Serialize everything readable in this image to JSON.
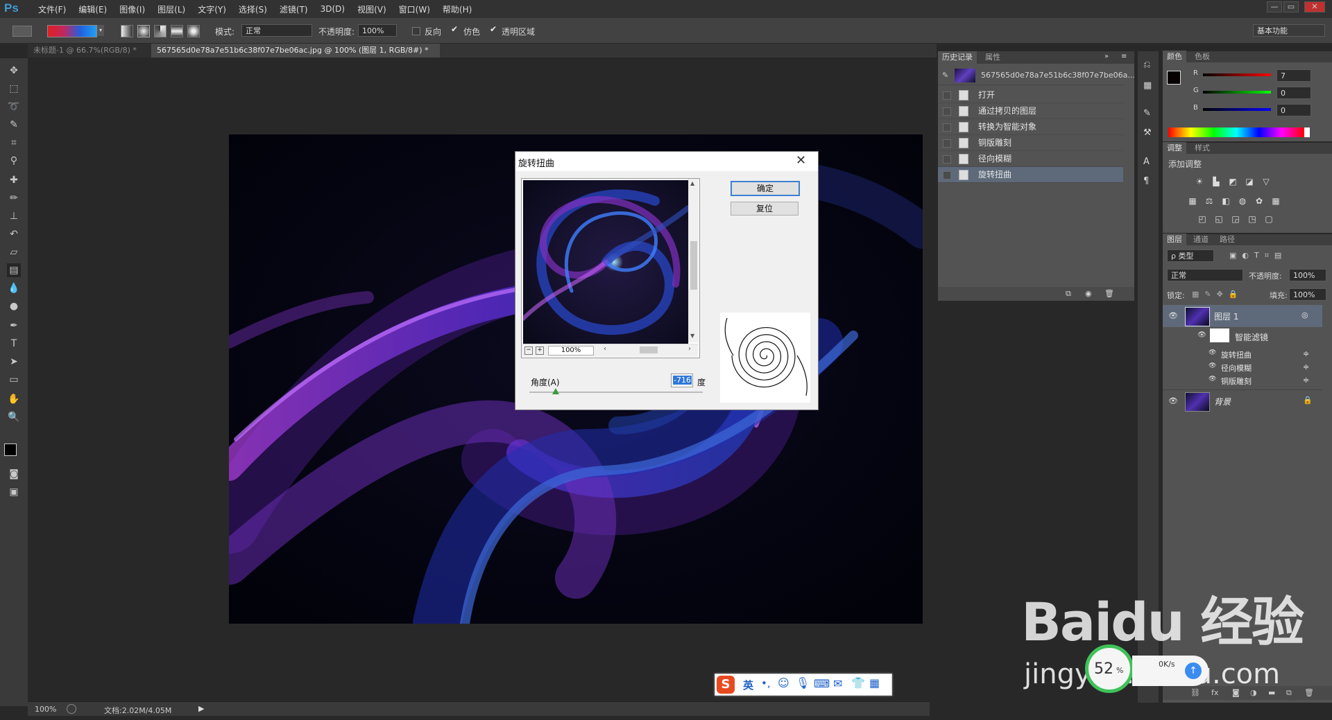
{
  "app": {
    "logo": "Ps"
  },
  "menu": [
    "文件(F)",
    "编辑(E)",
    "图像(I)",
    "图层(L)",
    "文字(Y)",
    "选择(S)",
    "滤镜(T)",
    "3D(D)",
    "视图(V)",
    "窗口(W)",
    "帮助(H)"
  ],
  "window_controls": [
    "—",
    "▭",
    "✕"
  ],
  "options": {
    "mode_label": "模式:",
    "mode_value": "正常",
    "opacity_label": "不透明度:",
    "opacity_value": "100%",
    "reverse_label": "反向",
    "dither_label": "仿色",
    "transparency_label": "透明区域",
    "workspace": "基本功能"
  },
  "tabs": [
    {
      "label": "未标题-1 @ 66.7%(RGB/8) *"
    },
    {
      "label": "567565d0e78a7e51b6c38f07e7be06ac.jpg @ 100% (图层 1, RGB/8#) *"
    }
  ],
  "status": {
    "zoom": "100%",
    "doc": "文档:2.02M/4.05M"
  },
  "history_panel": {
    "tabs": [
      "历史记录",
      "属性"
    ],
    "snapshot": "567565d0e78a7e51b6c38f07e7be06a...",
    "items": [
      "打开",
      "通过拷贝的图层",
      "转换为智能对象",
      "铜版雕刻",
      "径向模糊",
      "旋转扭曲"
    ]
  },
  "color_panel": {
    "tabs": [
      "颜色",
      "色板"
    ],
    "channels": [
      {
        "label": "R",
        "value": "7",
        "color": "#e02020"
      },
      {
        "label": "G",
        "value": "0",
        "color": "#20c020"
      },
      {
        "label": "B",
        "value": "0",
        "color": "#2030e0"
      }
    ]
  },
  "adjust_panel": {
    "tabs": [
      "调整",
      "样式"
    ],
    "title": "添加调整"
  },
  "layers_panel": {
    "tabs": [
      "图层",
      "通道",
      "路径"
    ],
    "kind_label": "ρ 类型",
    "blend_mode": "正常",
    "opacity_label": "不透明度:",
    "opacity_value": "100%",
    "lock_label": "锁定:",
    "fill_label": "填充:",
    "fill_value": "100%",
    "layers": [
      {
        "name": "图层 1"
      },
      {
        "name": "智能滤镜"
      },
      {
        "name": "旋转扭曲"
      },
      {
        "name": "径向模糊"
      },
      {
        "name": "铜版雕刻"
      },
      {
        "name": "背景"
      }
    ]
  },
  "dialog": {
    "title": "旋转扭曲",
    "ok": "确定",
    "reset": "复位",
    "zoom": "100%",
    "angle_label": "角度(A)",
    "angle_value": "-716",
    "unit": "度",
    "angle_fraction": 0.15
  },
  "ime_bar": {
    "lang": "英"
  },
  "watermark": {
    "brand": "Baidu 经验",
    "url": "jingyan.baidu.com",
    "pct": "52",
    "speed": "0K/s"
  }
}
